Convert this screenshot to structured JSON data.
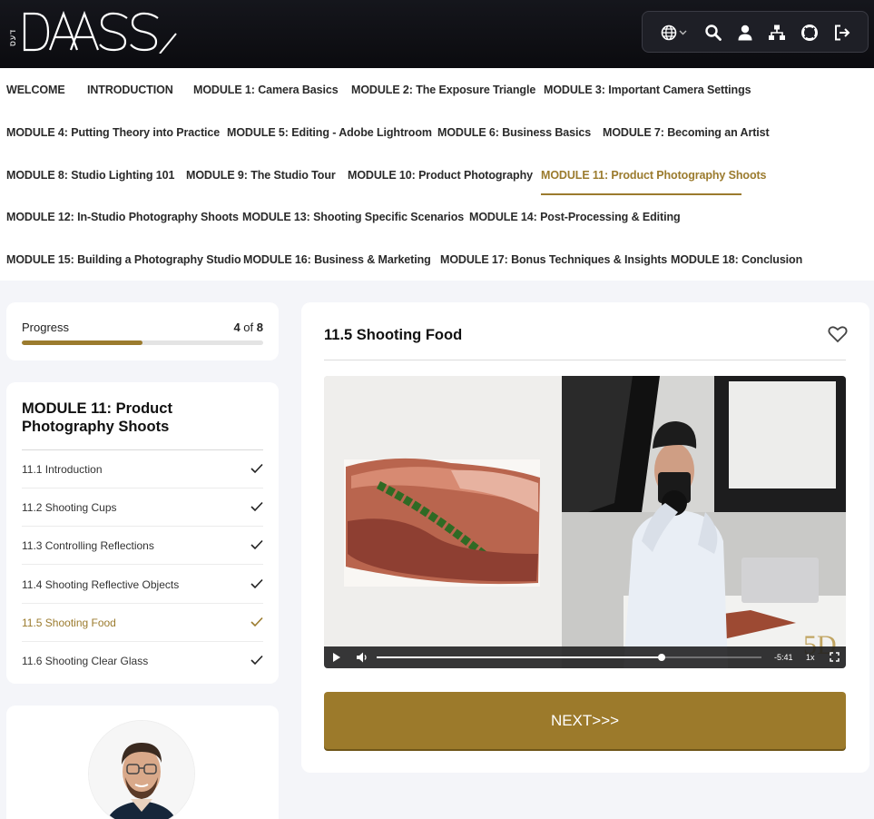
{
  "brand": {
    "logo_mark": "DAASS"
  },
  "toolbar": {
    "icons": [
      "globe-icon",
      "search-icon",
      "user-icon",
      "sitemap-icon",
      "support-icon",
      "logout-icon"
    ]
  },
  "nav": {
    "items": [
      "WELCOME",
      "INTRODUCTION",
      "MODULE 1: Camera Basics",
      "MODULE 2: The Exposure Triangle",
      "MODULE 3: Important Camera Settings",
      "MODULE 4: Putting Theory into Practice",
      "MODULE 5: Editing - Adobe Lightroom",
      "MODULE 6: Business Basics",
      "MODULE 7: Becoming an Artist",
      "MODULE 8: Studio Lighting 101",
      "MODULE 9: The Studio Tour",
      "MODULE 10: Product Photography",
      "MODULE 11: Product Photography Shoots",
      "MODULE 12: In-Studio Photography Shoots",
      "MODULE 13: Shooting Specific Scenarios",
      "MODULE 14: Post-Processing & Editing",
      "MODULE 15: Building a Photography Studio",
      "MODULE 16: Business & Marketing",
      "MODULE 17: Bonus Techniques & Insights",
      "MODULE 18: Conclusion"
    ],
    "active": "MODULE 11: Product Photography Shoots"
  },
  "progress": {
    "label": "Progress",
    "current": "4",
    "separator": "of",
    "total": "8",
    "fraction": 0.5
  },
  "module": {
    "title": "MODULE 11: Product Photography Shoots",
    "lessons": [
      {
        "label": "11.1 Introduction",
        "completed": true
      },
      {
        "label": "11.2 Shooting Cups",
        "completed": true
      },
      {
        "label": "11.3 Controlling Reflections",
        "completed": true
      },
      {
        "label": "11.4 Shooting Reflective Objects",
        "completed": true
      },
      {
        "label": "11.5 Shooting Food",
        "completed": true,
        "active": true
      },
      {
        "label": "11.6 Shooting Clear Glass",
        "completed": true
      }
    ]
  },
  "lesson": {
    "title": "11.5 Shooting Food"
  },
  "video": {
    "time_remaining": "-5:41",
    "speed": "1x",
    "played_fraction": 0.74,
    "watermark": "5D"
  },
  "next_button": {
    "label": "NEXT>>>"
  },
  "colors": {
    "accent": "#9b7b2e",
    "header_bg": "#0f1015",
    "page_bg": "#f4f5f9"
  }
}
